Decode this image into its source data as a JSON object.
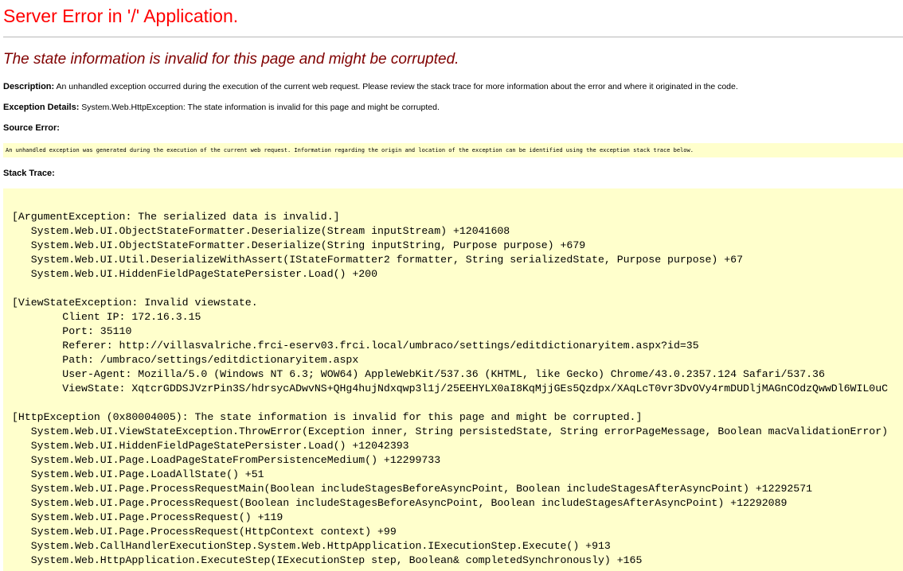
{
  "page": {
    "title": "Server Error in '/' Application.",
    "subtitle": "The state information is invalid for this page and might be corrupted.",
    "colors": {
      "title": "#ff0000",
      "subtitle": "#800000",
      "code_background": "#ffffcc",
      "rule": "#b7b7b7"
    }
  },
  "description": {
    "label": "Description:",
    "text": "An unhandled exception occurred during the execution of the current web request. Please review the stack trace for more information about the error and where it originated in the code."
  },
  "exception_details": {
    "label": "Exception Details:",
    "text": "System.Web.HttpException: The state information is invalid for this page and might be corrupted."
  },
  "source_error": {
    "label": "Source Error:",
    "text": "An unhandled exception was generated during the execution of the current web request. Information regarding the origin and location of the exception can be identified using the exception stack trace below."
  },
  "stack_trace": {
    "label": "Stack Trace:",
    "lines": [
      "[ArgumentException: The serialized data is invalid.]",
      "   System.Web.UI.ObjectStateFormatter.Deserialize(Stream inputStream) +12041608",
      "   System.Web.UI.ObjectStateFormatter.Deserialize(String inputString, Purpose purpose) +679",
      "   System.Web.UI.Util.DeserializeWithAssert(IStateFormatter2 formatter, String serializedState, Purpose purpose) +67",
      "   System.Web.UI.HiddenFieldPageStatePersister.Load() +200",
      "",
      "[ViewStateException: Invalid viewstate.",
      "        Client IP: 172.16.3.15",
      "        Port: 35110",
      "        Referer: http://villasvalriche.frci-eserv03.frci.local/umbraco/settings/editdictionaryitem.aspx?id=35",
      "        Path: /umbraco/settings/editdictionaryitem.aspx",
      "        User-Agent: Mozilla/5.0 (Windows NT 6.3; WOW64) AppleWebKit/537.36 (KHTML, like Gecko) Chrome/43.0.2357.124 Safari/537.36",
      "        ViewState: XqtcrGDDSJVzrPin3S/hdrsycADwvNS+QHg4hujNdxqwp3l1j/25EEHYLX0aI8KqMjjGEs5Qzdpx/XAqLcT0vr3DvOVy4rmDUDljMAGnCOdzQwwDl6WIL0uC",
      "",
      "[HttpException (0x80004005): The state information is invalid for this page and might be corrupted.]",
      "   System.Web.UI.ViewStateException.ThrowError(Exception inner, String persistedState, String errorPageMessage, Boolean macValidationError)",
      "   System.Web.UI.HiddenFieldPageStatePersister.Load() +12042393",
      "   System.Web.UI.Page.LoadPageStateFromPersistenceMedium() +12299733",
      "   System.Web.UI.Page.LoadAllState() +51",
      "   System.Web.UI.Page.ProcessRequestMain(Boolean includeStagesBeforeAsyncPoint, Boolean includeStagesAfterAsyncPoint) +12292571",
      "   System.Web.UI.Page.ProcessRequest(Boolean includeStagesBeforeAsyncPoint, Boolean includeStagesAfterAsyncPoint) +12292089",
      "   System.Web.UI.Page.ProcessRequest() +119",
      "   System.Web.UI.Page.ProcessRequest(HttpContext context) +99",
      "   System.Web.CallHandlerExecutionStep.System.Web.HttpApplication.IExecutionStep.Execute() +913",
      "   System.Web.HttpApplication.ExecuteStep(IExecutionStep step, Boolean& completedSynchronously) +165"
    ]
  }
}
